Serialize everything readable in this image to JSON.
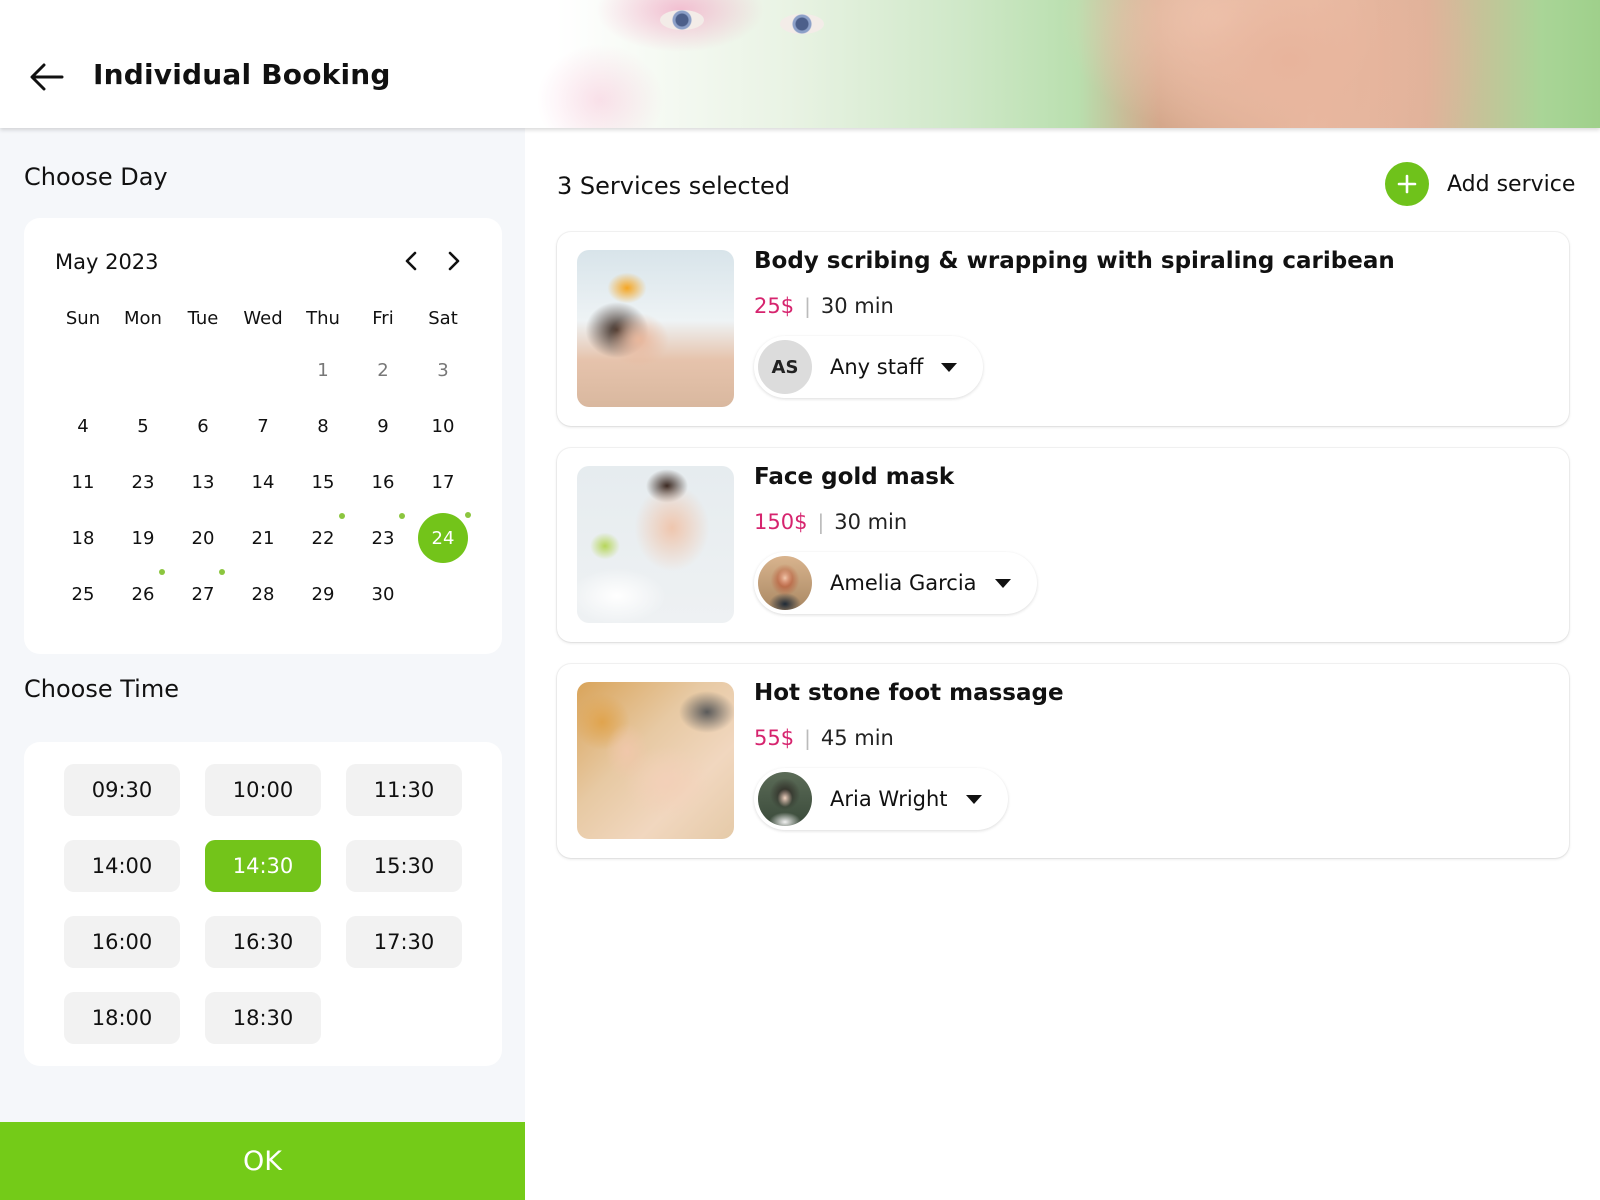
{
  "header": {
    "title": "Individual Booking",
    "back_icon": "arrow-left-icon"
  },
  "left_panel": {
    "choose_day_label": "Choose Day",
    "choose_time_label": "Choose Time",
    "calendar": {
      "month_label": "May 2023",
      "prev_icon": "chevron-left-icon",
      "next_icon": "chevron-right-icon",
      "weekdays": [
        "Sun",
        "Mon",
        "Tue",
        "Wed",
        "Thu",
        "Fri",
        "Sat"
      ],
      "weeks": [
        [
          {
            "d": ""
          },
          {
            "d": ""
          },
          {
            "d": ""
          },
          {
            "d": ""
          },
          {
            "d": "1",
            "muted": true
          },
          {
            "d": "2",
            "muted": true
          },
          {
            "d": "3",
            "muted": true
          }
        ],
        [
          {
            "d": "4"
          },
          {
            "d": "5"
          },
          {
            "d": "6"
          },
          {
            "d": "7"
          },
          {
            "d": "8"
          },
          {
            "d": "9"
          },
          {
            "d": "10"
          }
        ],
        [
          {
            "d": "11"
          },
          {
            "d": "23"
          },
          {
            "d": "13"
          },
          {
            "d": "14"
          },
          {
            "d": "15"
          },
          {
            "d": "16"
          },
          {
            "d": "17"
          }
        ],
        [
          {
            "d": "18"
          },
          {
            "d": "19"
          },
          {
            "d": "20"
          },
          {
            "d": "21"
          },
          {
            "d": "22",
            "dot": true
          },
          {
            "d": "23",
            "dot": true
          },
          {
            "d": "24",
            "dot": true,
            "selected": true
          }
        ],
        [
          {
            "d": "25"
          },
          {
            "d": "26",
            "dot": true
          },
          {
            "d": "27",
            "dot": true
          },
          {
            "d": "28"
          },
          {
            "d": "29"
          },
          {
            "d": "30"
          },
          {
            "d": ""
          }
        ]
      ],
      "selected_day": "24"
    },
    "time_slots": [
      "09:30",
      "10:00",
      "11:30",
      "14:00",
      "14:30",
      "15:30",
      "16:00",
      "16:30",
      "17:30",
      "18:00",
      "18:30"
    ],
    "selected_time": "14:30",
    "ok_label": "OK"
  },
  "right_panel": {
    "services_count_label": "3 Services selected",
    "add_service_label": "Add service",
    "add_icon": "plus-icon",
    "services": [
      {
        "name": "Body scribing & wrapping with spiraling caribean",
        "price": "25$",
        "duration": "30 min",
        "staff": {
          "name": "Any staff",
          "initials": "AS",
          "avatar": "initials"
        }
      },
      {
        "name": "Face gold mask",
        "price": "150$",
        "duration": "30 min",
        "staff": {
          "name": "Amelia Garcia",
          "initials": "",
          "avatar": "photo"
        }
      },
      {
        "name": "Hot stone foot massage",
        "price": "55$",
        "duration": "45 min",
        "staff": {
          "name": "Aria Wright",
          "initials": "",
          "avatar": "photo"
        }
      }
    ],
    "separator": "|"
  },
  "colors": {
    "accent_green": "#73c41a",
    "ok_button_green": "#74cb18",
    "price_pink": "#d6246e",
    "event_dot": "#8cc63f",
    "left_bg": "#f5f7fa",
    "slot_bg": "#f2f2f2"
  }
}
